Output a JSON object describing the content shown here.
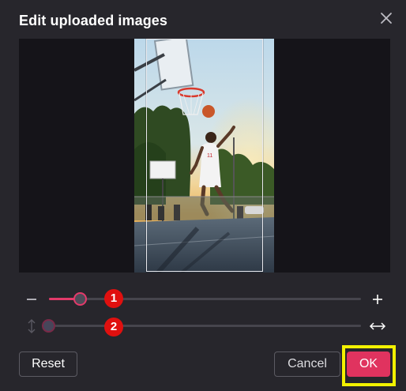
{
  "dialog": {
    "title": "Edit uploaded images",
    "close_icon": "close-icon"
  },
  "preview": {
    "crop_frame": "visible"
  },
  "sliders": {
    "zoom": {
      "min_icon": "minus-icon",
      "max_icon": "plus-icon",
      "value_fraction": 0.05,
      "badge": "1"
    },
    "position": {
      "icon_left": "vertical-arrows-icon",
      "icon_right": "horizontal-arrows-icon",
      "value_fraction": 0.0,
      "badge": "2"
    }
  },
  "buttons": {
    "reset": "Reset",
    "cancel": "Cancel",
    "ok": "OK"
  },
  "colors": {
    "accent": "#e0335f",
    "highlight": "#f3f100",
    "badge": "#e0100f",
    "background": "#27262c"
  }
}
